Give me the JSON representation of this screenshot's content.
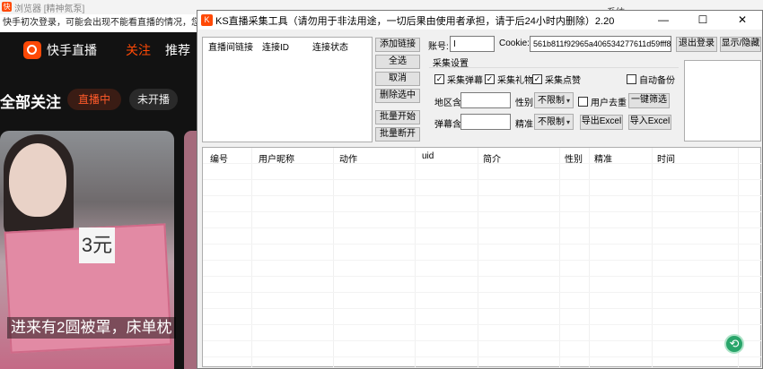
{
  "browser": {
    "title": "浏览器 [精神氮泵]",
    "notice": "快手初次登录，可能会出现不能看直播的情况，您需要在此",
    "sys_text": "系统",
    "brand": "快手直播",
    "tabs": [
      "关注",
      "推荐"
    ],
    "section_title": "全部关注",
    "pill_live": "直播中",
    "pill_offline": "未开播",
    "card_label": "3元",
    "card_caption": "进来有2圆被罩，床单枕"
  },
  "tool": {
    "title": "KS直播采集工具（请勿用于非法用途，一切后果由使用者承担，请于后24小时内删除）2.20",
    "window_buttons": {
      "minimize": "—",
      "maximize": "☐",
      "close": "✕"
    },
    "conn_list_headers": [
      "直播间链接",
      "连接ID",
      "连接状态"
    ],
    "left_buttons": {
      "add_link": "添加链接",
      "select_all": "全选",
      "cancel": "取消",
      "delete_selected": "删除选中",
      "batch_start": "批量开始",
      "batch_disconnect": "批量断开"
    },
    "account": {
      "label": "账号:",
      "value": "I"
    },
    "cookie": {
      "label": "Cookie:",
      "value": "561b811f92965a406534277611d59fff8;"
    },
    "logout": "退出登录",
    "show_hide": "显示/隐藏",
    "collect_settings": "采集设置",
    "checks": {
      "danmu": {
        "label": "采集弹幕",
        "checked": true
      },
      "gift": {
        "label": "采集礼物",
        "checked": true
      },
      "like": {
        "label": "采集点赞",
        "checked": true
      },
      "auto_backup": {
        "label": "自动备份",
        "checked": false
      },
      "dedupe": {
        "label": "用户去重",
        "checked": false
      }
    },
    "region_label": "地区含",
    "danmu_label": "弹幕含",
    "gender_label": "性别",
    "standard_label": "精准",
    "gender_value": "不限制",
    "standard_value": "不限制",
    "filter_button": "一键筛选",
    "export_excel": "导出Excel",
    "import_excel": "导入Excel",
    "table_headers": [
      "编号",
      "用户昵称",
      "动作",
      "uid",
      "简介",
      "性别",
      "精准",
      "时间"
    ]
  },
  "icons": {
    "refresh": "refresh-icon"
  },
  "colors": {
    "brand": "#ff4906",
    "accent_green": "#29a56a"
  }
}
